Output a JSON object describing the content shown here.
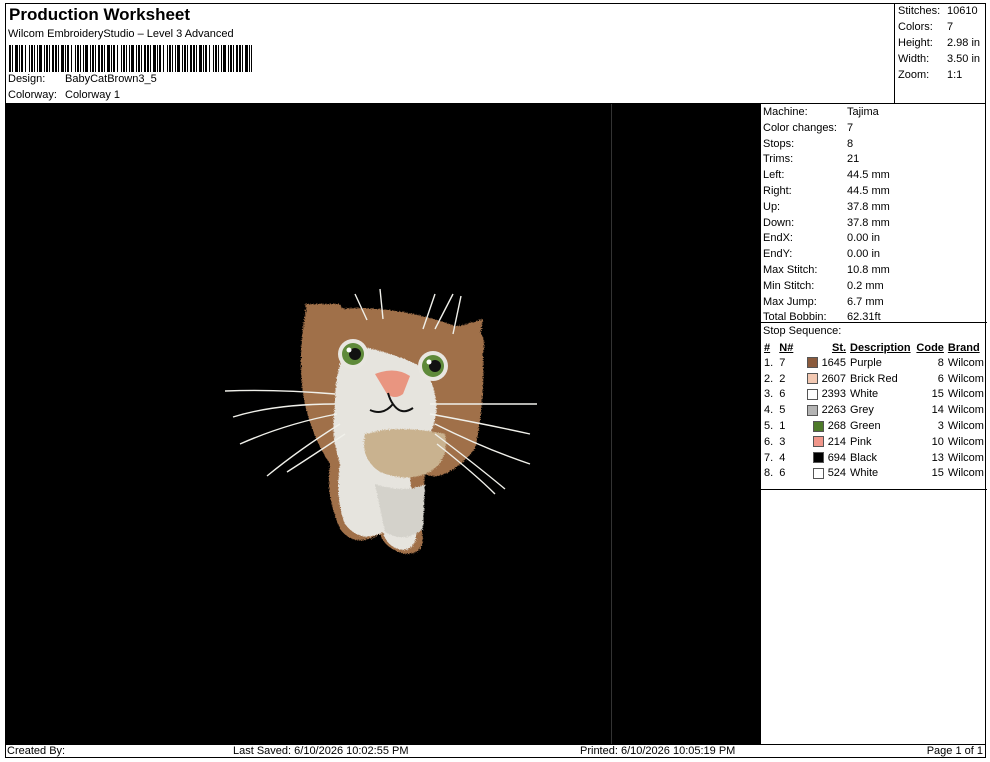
{
  "header": {
    "title": "Production Worksheet",
    "subtitle": "Wilcom EmbroideryStudio – Level 3 Advanced",
    "design_label": "Design:",
    "design_value": "BabyCatBrown3_5",
    "colorway_label": "Colorway:",
    "colorway_value": "Colorway 1"
  },
  "summary": [
    {
      "label": "Stitches:",
      "value": "10610"
    },
    {
      "label": "Colors:",
      "value": "7"
    },
    {
      "label": "Height:",
      "value": "2.98 in"
    },
    {
      "label": "Width:",
      "value": "3.50 in"
    },
    {
      "label": "Zoom:",
      "value": "1:1"
    }
  ],
  "specs": [
    {
      "label": "Machine:",
      "value": "Tajima"
    },
    {
      "label": "Color changes:",
      "value": "7"
    },
    {
      "label": "Stops:",
      "value": "8"
    },
    {
      "label": "Trims:",
      "value": "21"
    },
    {
      "label": "Left:",
      "value": "44.5 mm"
    },
    {
      "label": "Right:",
      "value": "44.5 mm"
    },
    {
      "label": "Up:",
      "value": "37.8 mm"
    },
    {
      "label": "Down:",
      "value": "37.8 mm"
    },
    {
      "label": "EndX:",
      "value": "0.00 in"
    },
    {
      "label": "EndY:",
      "value": "0.00 in"
    },
    {
      "label": "Max Stitch:",
      "value": "10.8 mm"
    },
    {
      "label": "Min Stitch:",
      "value": "0.2 mm"
    },
    {
      "label": "Max Jump:",
      "value": "6.7 mm"
    },
    {
      "label": "Total Bobbin:",
      "value": "62.31ft"
    }
  ],
  "sequence": {
    "title": "Stop Sequence:",
    "headers": {
      "num": "#",
      "n": "N#",
      "st": "St.",
      "description": "Description",
      "code": "Code",
      "brand": "Brand"
    },
    "rows": [
      {
        "num": "1.",
        "n": "7",
        "color": "#8a5a3c",
        "st": "1645",
        "description": "Purple",
        "code": "8",
        "brand": "Wilcom"
      },
      {
        "num": "2.",
        "n": "2",
        "color": "#f2c8b2",
        "st": "2607",
        "description": "Brick Red",
        "code": "6",
        "brand": "Wilcom"
      },
      {
        "num": "3.",
        "n": "6",
        "color": "#ffffff",
        "st": "2393",
        "description": "White",
        "code": "15",
        "brand": "Wilcom"
      },
      {
        "num": "4.",
        "n": "5",
        "color": "#b4b4b4",
        "st": "2263",
        "description": "Grey",
        "code": "14",
        "brand": "Wilcom"
      },
      {
        "num": "5.",
        "n": "1",
        "color": "#4e7a2a",
        "st": "268",
        "description": "Green",
        "code": "3",
        "brand": "Wilcom"
      },
      {
        "num": "6.",
        "n": "3",
        "color": "#f0968a",
        "st": "214",
        "description": "Pink",
        "code": "10",
        "brand": "Wilcom"
      },
      {
        "num": "7.",
        "n": "4",
        "color": "#000000",
        "st": "694",
        "description": "Black",
        "code": "13",
        "brand": "Wilcom"
      },
      {
        "num": "8.",
        "n": "6",
        "color": "#ffffff",
        "st": "524",
        "description": "White",
        "code": "15",
        "brand": "Wilcom"
      }
    ]
  },
  "footer": {
    "created": "Created By:",
    "saved": "Last Saved: 6/10/2026 10:02:55 PM",
    "printed": "Printed: 6/10/2026 10:05:19 PM",
    "page": "Page 1 of 1"
  },
  "colors": {
    "canvas": "#000000",
    "fur_brown": "#a0704a",
    "fur_white": "#e8e6e0",
    "eye_green": "#5f8a3a",
    "nose_pink": "#e99580"
  }
}
